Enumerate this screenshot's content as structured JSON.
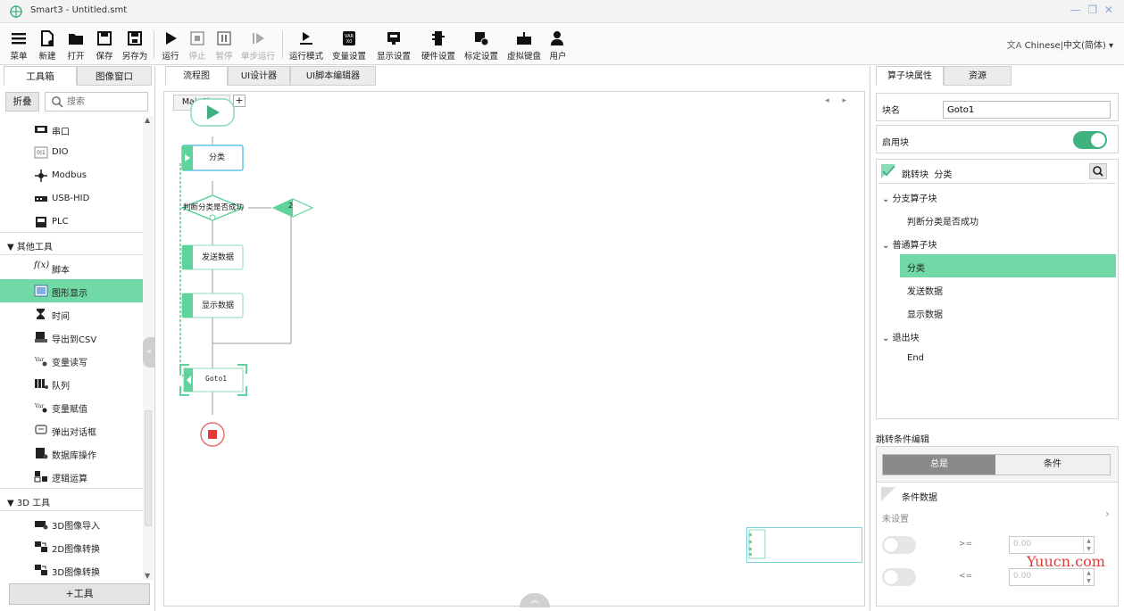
{
  "window": {
    "title": "Smart3 - Untitled.smt",
    "controls": "— ❐ ✕"
  },
  "toolbar": {
    "items": [
      {
        "label": "菜单",
        "icon": "menu-icon"
      },
      {
        "label": "新建",
        "icon": "new-file-icon"
      },
      {
        "label": "打开",
        "icon": "open-folder-icon"
      },
      {
        "label": "保存",
        "icon": "save-icon"
      },
      {
        "label": "另存为",
        "icon": "save-as-icon"
      },
      {
        "label": "运行",
        "icon": "play-icon"
      },
      {
        "label": "停止",
        "icon": "stop-icon"
      },
      {
        "label": "暂停",
        "icon": "pause-icon"
      },
      {
        "label": "单步运行",
        "icon": "step-icon"
      },
      {
        "label": "运行模式",
        "icon": "run-mode-icon"
      },
      {
        "label": "变量设置",
        "icon": "variable-icon"
      },
      {
        "label": "显示设置",
        "icon": "display-icon"
      },
      {
        "label": "硬件设置",
        "icon": "hardware-icon"
      },
      {
        "label": "标定设置",
        "icon": "calibration-icon"
      },
      {
        "label": "虚拟键盘",
        "icon": "keyboard-icon"
      },
      {
        "label": "用户",
        "icon": "user-icon"
      }
    ],
    "language": "Chinese|中文(简体)"
  },
  "left": {
    "tabs": [
      "工具箱",
      "图像窗口"
    ],
    "fold_label": "折叠",
    "search_placeholder": "搜索",
    "items_top": [
      "串口",
      "DIO",
      "Modbus",
      "USB-HID",
      "PLC"
    ],
    "group_other": "其他工具",
    "items_other": [
      "脚本",
      "图形显示",
      "时间",
      "导出到CSV",
      "变量读写",
      "队列",
      "变量赋值",
      "弹出对话框",
      "数据库操作",
      "逻辑运算"
    ],
    "group_3d": "3D 工具",
    "items_3d": [
      "3D图像导入",
      "2D图像转换",
      "3D图像转换"
    ],
    "add_tool": "+工具"
  },
  "center": {
    "tabs": [
      "流程图",
      "UI设计器",
      "UI脚本编辑器"
    ],
    "flow_tab": "MainFlow",
    "flow_add": "+",
    "nav": "◂ ▸",
    "nodes": {
      "classify": "分类",
      "judge": "判断分类是否成功",
      "branch_num": "2",
      "send": "发送数据",
      "show": "显示数据",
      "goto": "Goto1"
    }
  },
  "right": {
    "tabs": [
      "算子块属性",
      "资源"
    ],
    "block_name_label": "块名",
    "block_name_value": "Goto1",
    "enable_label": "启用块",
    "enabled": true,
    "jump_title": "跳转块",
    "jump_target": "分类",
    "tree": [
      {
        "label": "分支算子块",
        "level": 0,
        "expanded": true
      },
      {
        "label": "判断分类是否成功",
        "level": 1
      },
      {
        "label": "普通算子块",
        "level": 0,
        "expanded": true
      },
      {
        "label": "分类",
        "level": 1,
        "selected": true
      },
      {
        "label": "发送数据",
        "level": 1
      },
      {
        "label": "显示数据",
        "level": 1
      },
      {
        "label": "退出块",
        "level": 0,
        "expanded": true
      },
      {
        "label": "End",
        "level": 1
      }
    ],
    "cond_edit_title": "跳转条件编辑",
    "seg_always": "总是",
    "seg_condition": "条件",
    "cond_data_title": "条件数据",
    "cond_unset": "未设置",
    "cmp_ge": ">=",
    "cmp_le": "<=",
    "val_ge": "0.00",
    "val_le": "0.00"
  },
  "watermark": "Yuucn.com",
  "colors": {
    "accent": "#70d9a6",
    "accent_dark": "#3fb27f",
    "stop_red": "#e53935"
  }
}
